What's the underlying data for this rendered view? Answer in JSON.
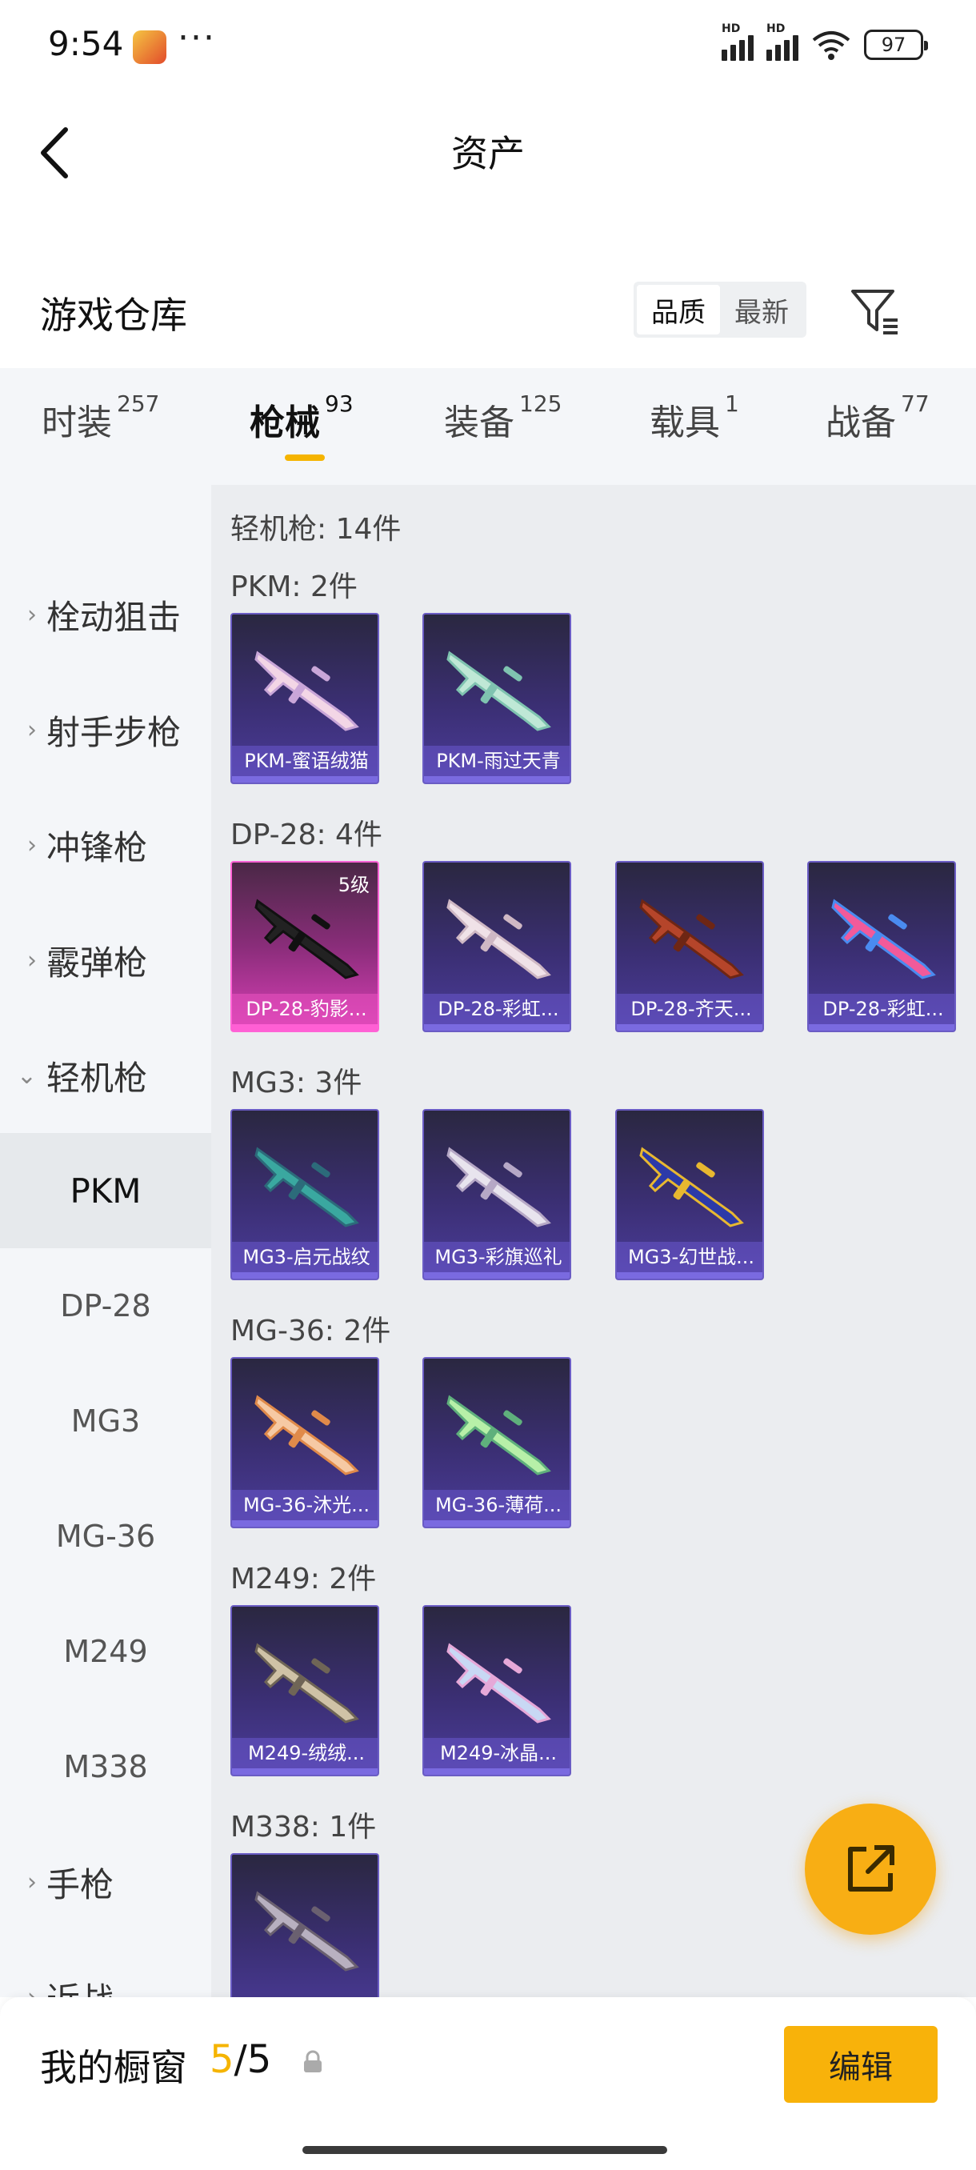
{
  "status_bar": {
    "time": "9:54",
    "dots": "···",
    "battery": "97",
    "hd1": "HD",
    "hd2": "HD"
  },
  "header": {
    "title": "资产"
  },
  "warehouse": {
    "title": "游戏仓库",
    "sort_quality": "品质",
    "sort_newest": "最新"
  },
  "tabs": [
    {
      "label": "时装",
      "count": "257"
    },
    {
      "label": "枪械",
      "count": "93"
    },
    {
      "label": "装备",
      "count": "125"
    },
    {
      "label": "载具",
      "count": "1"
    },
    {
      "label": "战备",
      "count": "77"
    }
  ],
  "sidebar": {
    "categories": [
      {
        "label": "栓动狙击"
      },
      {
        "label": "射手步枪"
      },
      {
        "label": "冲锋枪"
      },
      {
        "label": "霰弹枪"
      },
      {
        "label": "轻机枪"
      }
    ],
    "subitems": [
      "PKM",
      "DP-28",
      "MG3",
      "MG-36",
      "M249",
      "M338"
    ],
    "bottom_categories": [
      {
        "label": "手枪"
      },
      {
        "label": "近战"
      }
    ]
  },
  "main": {
    "summary": "轻机枪: 14件",
    "sections": [
      {
        "title": "PKM: 2件",
        "items": [
          {
            "name": "PKM-蜜语绒猫"
          },
          {
            "name": "PKM-雨过天青"
          }
        ]
      },
      {
        "title": "DP-28: 4件",
        "items": [
          {
            "name": "DP-28-豹影...",
            "level": "5级"
          },
          {
            "name": "DP-28-彩虹..."
          },
          {
            "name": "DP-28-齐天..."
          },
          {
            "name": "DP-28-彩虹..."
          }
        ]
      },
      {
        "title": "MG3: 3件",
        "items": [
          {
            "name": "MG3-启元战纹"
          },
          {
            "name": "MG3-彩旗巡礼"
          },
          {
            "name": "MG3-幻世战..."
          }
        ]
      },
      {
        "title": "MG-36: 2件",
        "items": [
          {
            "name": "MG-36-沐光..."
          },
          {
            "name": "MG-36-薄荷..."
          }
        ]
      },
      {
        "title": "M249: 2件",
        "items": [
          {
            "name": "M249-绒绒..."
          },
          {
            "name": "M249-冰晶..."
          }
        ]
      },
      {
        "title": "M338: 1件",
        "items": []
      }
    ]
  },
  "bottom_bar": {
    "label": "我的橱窗",
    "used": "5",
    "slash": "/",
    "total": "5",
    "edit": "编辑"
  },
  "colors": {
    "accent": "#f5b400",
    "card_purple": "#3b2f74",
    "card_pink": "#d93fb6"
  }
}
